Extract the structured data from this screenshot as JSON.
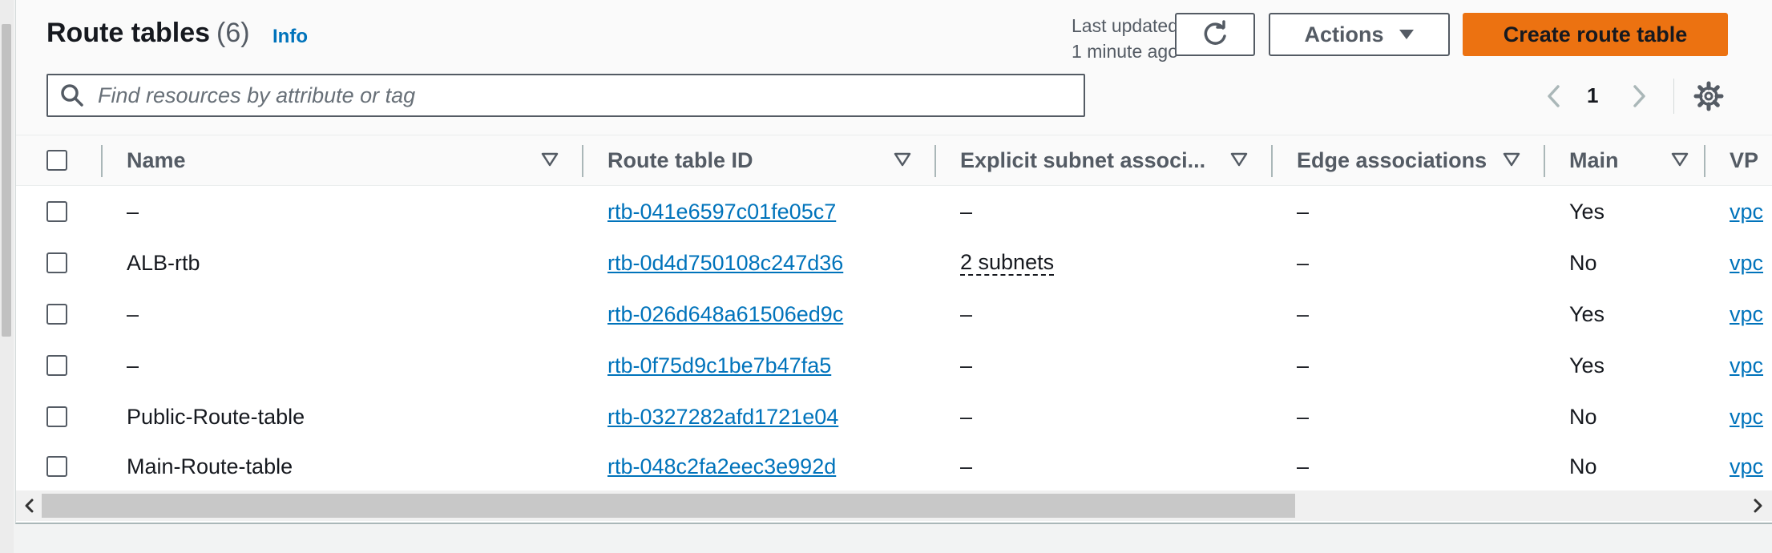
{
  "header": {
    "title": "Route tables",
    "count": "(6)",
    "info": "Info",
    "last_updated_line1": "Last updated",
    "last_updated_line2": "1 minute ago",
    "actions_label": "Actions",
    "create_label": "Create route table"
  },
  "search": {
    "placeholder": "Find resources by attribute or tag"
  },
  "pagination": {
    "current_page": "1"
  },
  "columns": [
    "Name",
    "Route table ID",
    "Explicit subnet associ...",
    "Edge associations",
    "Main",
    "VP"
  ],
  "rows": [
    {
      "name": "–",
      "id": "rtb-041e6597c01fe05c7",
      "subnets": "–",
      "edge": "–",
      "main": "Yes",
      "vpc": "vpc"
    },
    {
      "name": "ALB-rtb",
      "id": "rtb-0d4d750108c247d36",
      "subnets": "2 subnets",
      "edge": "–",
      "main": "No",
      "vpc": "vpc"
    },
    {
      "name": "–",
      "id": "rtb-026d648a61506ed9c",
      "subnets": "–",
      "edge": "–",
      "main": "Yes",
      "vpc": "vpc"
    },
    {
      "name": "–",
      "id": "rtb-0f75d9c1be7b47fa5",
      "subnets": "–",
      "edge": "–",
      "main": "Yes",
      "vpc": "vpc"
    },
    {
      "name": "Public-Route-table",
      "id": "rtb-0327282afd1721e04",
      "subnets": "–",
      "edge": "–",
      "main": "No",
      "vpc": "vpc"
    },
    {
      "name": "Main-Route-table",
      "id": "rtb-048c2fa2eec3e992d",
      "subnets": "–",
      "edge": "–",
      "main": "No",
      "vpc": "vpc"
    }
  ],
  "colors": {
    "primary_button": "#ec7211",
    "link": "#0073bb",
    "border": "#545b64"
  }
}
